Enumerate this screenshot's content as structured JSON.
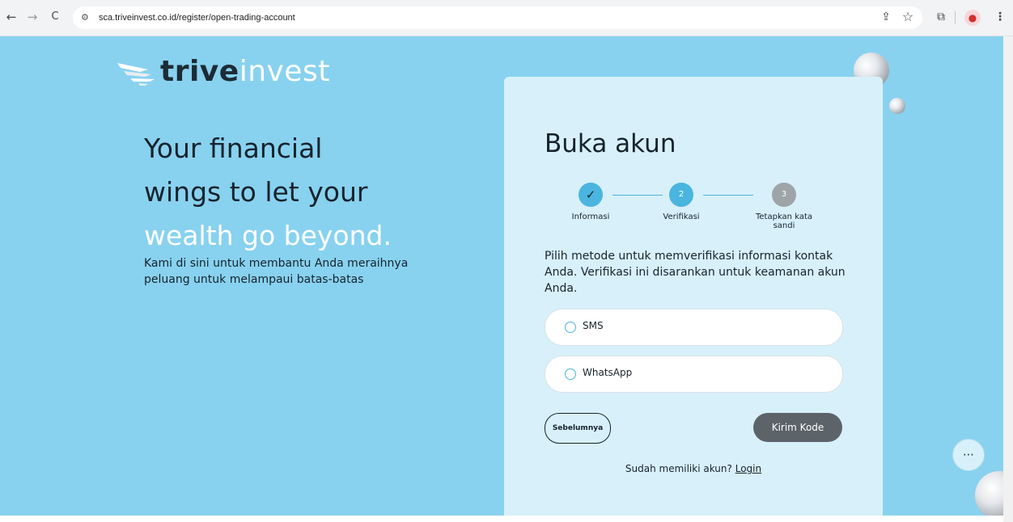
{
  "browser": {
    "url": "sca.triveinvest.co.id/register/open-trading-account",
    "back_icon": "←",
    "forward_icon": "→",
    "reload_icon": "C",
    "site_info_icon": "⚙",
    "cast_icon": "⇪",
    "star_icon": "☆",
    "extensions_icon": "⧉",
    "profile_icon": "●",
    "menu_icon": "⋮"
  },
  "logo": {
    "part1": "trive",
    "part2": "invest"
  },
  "hero": {
    "line1": "Your financial",
    "line2": "wings to let your",
    "line3": "wealth go beyond.",
    "subtitle": "Kami di sini untuk membantu Anda meraihnya peluang untuk melampaui batas-batas"
  },
  "card": {
    "title": "Buka akun",
    "steps": [
      {
        "label": "Informasi",
        "marker": "✓",
        "state": "done"
      },
      {
        "label": "Verifikasi",
        "marker": "2",
        "state": "active"
      },
      {
        "label": "Tetapkan kata sandi",
        "marker": "3",
        "state": "pending"
      }
    ],
    "description": "Pilih metode untuk memverifikasi informasi kontak Anda. Verifikasi ini disarankan untuk keamanan akun Anda.",
    "options": [
      {
        "label": "SMS"
      },
      {
        "label": "WhatsApp"
      }
    ],
    "prev_button": "Sebelumnya",
    "send_button": "Kirim Kode",
    "have_account_text": "Sudah memiliki akun?",
    "login_link": "Login"
  },
  "chat": {
    "icon": "chat-icon",
    "glyph": "⋯"
  },
  "colors": {
    "page_bg": "#88d2f0",
    "card_bg": "#d7f0fa",
    "accent": "#4ab6e0",
    "dark_text": "#16232d",
    "button_dark": "#5c6369"
  }
}
